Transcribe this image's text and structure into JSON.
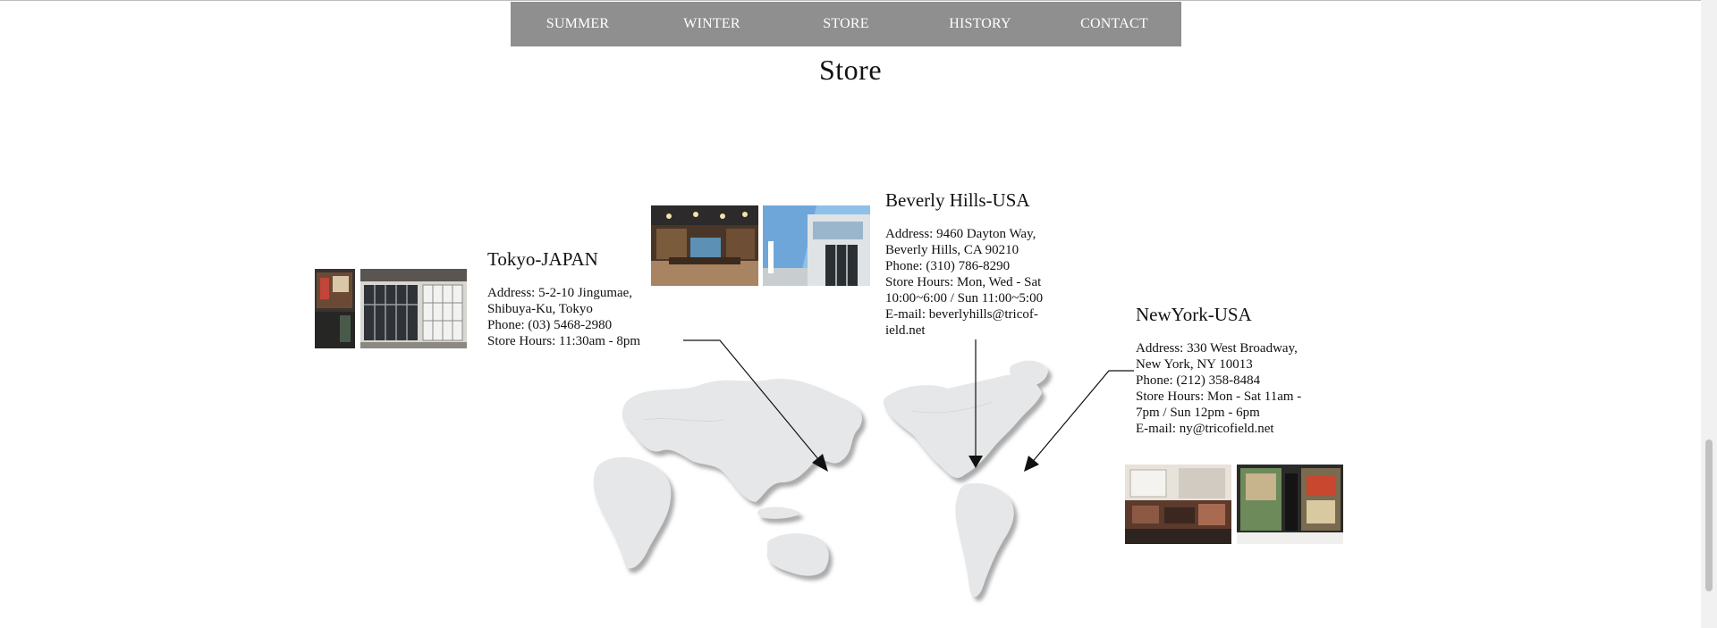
{
  "nav": {
    "items": [
      {
        "label": "SUMMER"
      },
      {
        "label": "WINTER"
      },
      {
        "label": "STORE"
      },
      {
        "label": "HISTORY"
      },
      {
        "label": "CONTACT"
      }
    ]
  },
  "page": {
    "title": "Store"
  },
  "stores": {
    "tokyo": {
      "name": "Tokyo-JAPAN",
      "lines": [
        "Address: 5-2-10 Jingumae,",
        "Shibuya-Ku, Tokyo",
        "Phone: (03) 5468-2980",
        "Store Hours: 11:30am - 8pm"
      ]
    },
    "beverly": {
      "name": "Beverly Hills-USA",
      "lines": [
        "Address: 9460 Dayton Way,",
        "Beverly Hills, CA 90210",
        "Phone: (310) 786-8290",
        "Store Hours: Mon, Wed - Sat",
        "10:00~6:00 / Sun 11:00~5:00",
        "E-mail: beverlyhills@tricof-",
        "ield.net"
      ]
    },
    "newyork": {
      "name": "NewYork-USA",
      "lines": [
        "Address: 330 West Broadway,",
        "New York, NY 10013",
        "Phone: (212) 358-8484",
        "Store Hours: Mon - Sat 11am -",
        "7pm / Sun 12pm - 6pm",
        "E-mail:  ny@tricofield.net"
      ]
    }
  },
  "colors": {
    "nav_bg": "#8f8f8f",
    "map_fill": "#e6e7e8",
    "map_shadow": "#b5b5b5"
  }
}
